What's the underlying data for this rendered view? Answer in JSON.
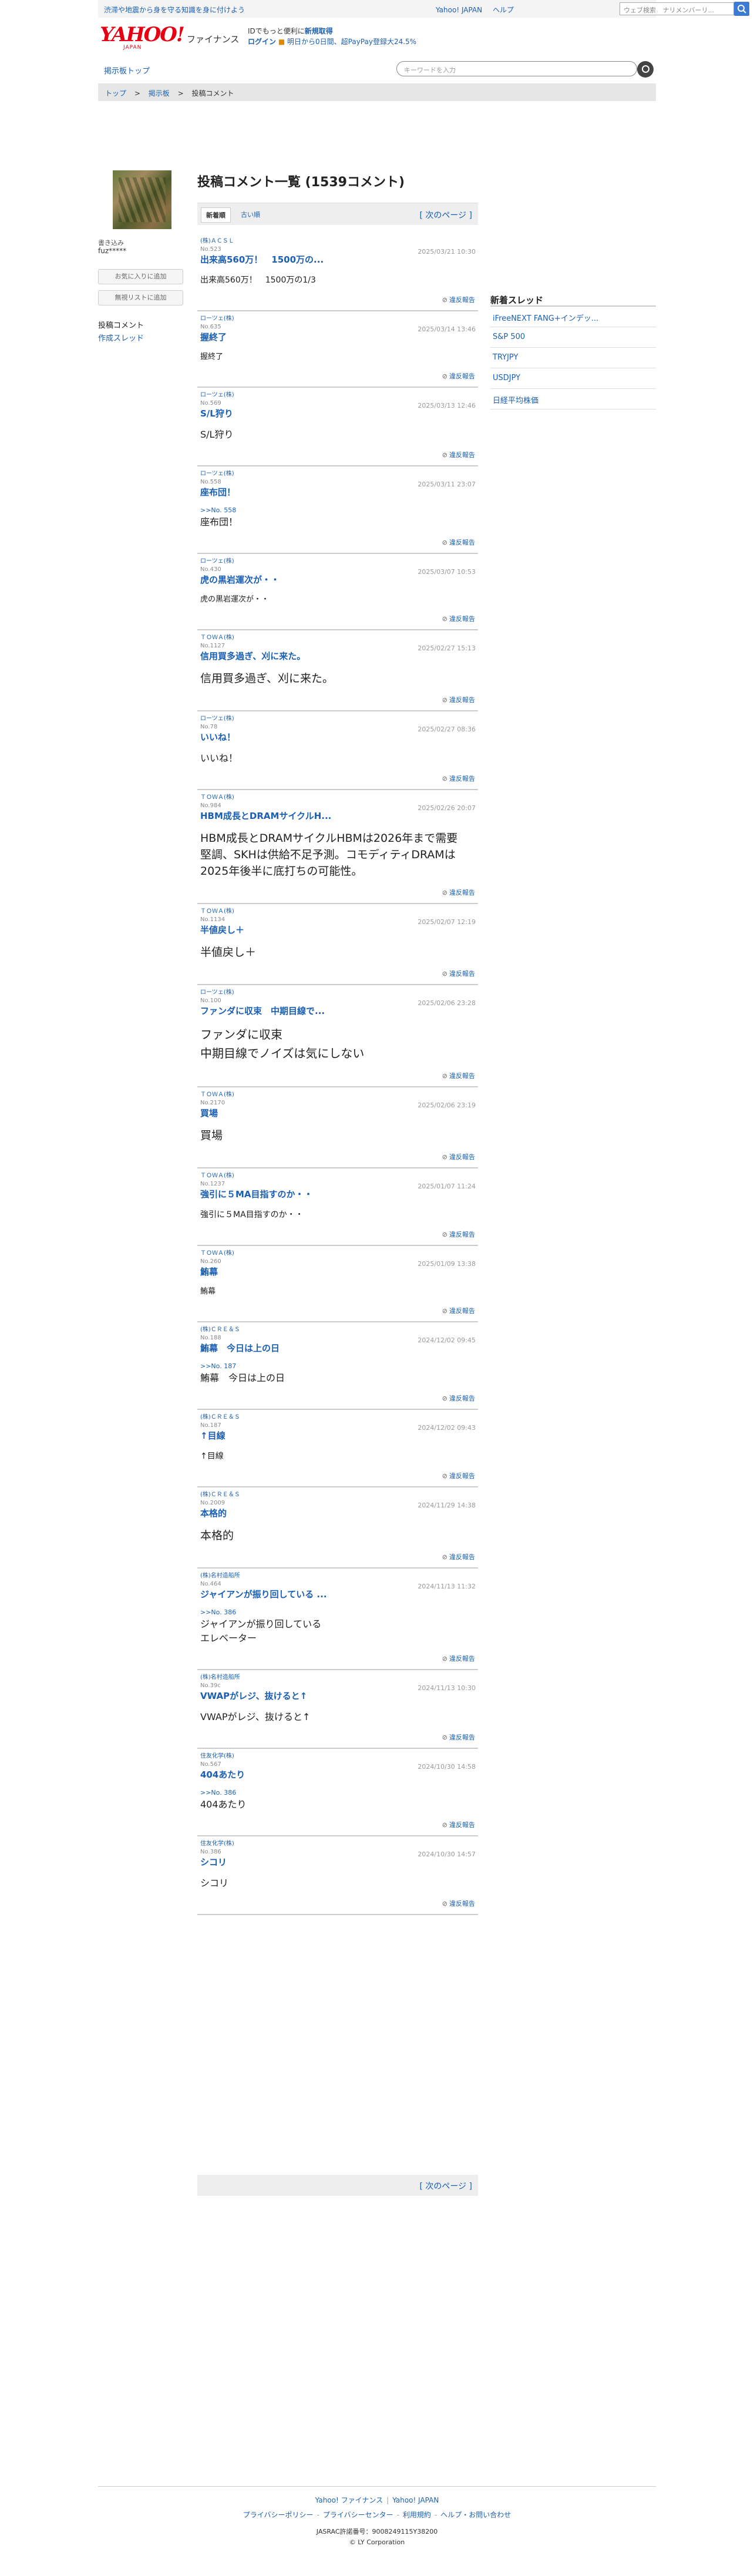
{
  "topbar": {
    "promo": "渋滞や地震から身を守る知識を身に付けよう",
    "links": [
      "Yahoo! JAPAN",
      "ヘルプ"
    ],
    "search_placeholder": "ウェブ検索",
    "search_option": "ナリ",
    "search_option2": "メンバーリ..."
  },
  "header": {
    "logo": "YAHOO!",
    "logo_sub": "JAPAN",
    "service": "ファイナンス",
    "promo_line1_a": "IDでもっと便利に",
    "promo_line1_b": "新規取得",
    "promo_line2_a": "ログイン",
    "promo_line2_b": "明日から0日間、超PayPay登録大24.5%"
  },
  "nav": {
    "board_top": "掲示板トップ",
    "keyword_placeholder": "キーワードを入力"
  },
  "breadcrumb": [
    "トップ",
    ">",
    "掲示板",
    ">",
    "投稿コメント"
  ],
  "profile": {
    "label": "書き込み",
    "name": "fuz*****",
    "btn_favorite": "お気に入りに追加",
    "btn_ignore": "無視リストに追加",
    "menu_comments": "投稿コメント",
    "menu_threads": "作成スレッド"
  },
  "main": {
    "title": "投稿コメント一覧 (1539コメント)",
    "tab_new": "新着順",
    "tab_old": "古い順",
    "next_page": "[ 次のページ ]",
    "report_label": "違反報告"
  },
  "posts": [
    {
      "company": "(株)ＡＣＳＬ",
      "no": "No.523",
      "date": "2025/03/21 10:30",
      "title": "出来高560万！　1500万の...",
      "reply": "",
      "body": "出来高560万！　1500万の1/3",
      "size": "fs14"
    },
    {
      "company": "ローツェ(株)",
      "no": "No.635",
      "date": "2025/03/14 13:46",
      "title": "握終了",
      "reply": "",
      "body": "握終了",
      "size": "fs13"
    },
    {
      "company": "ローツェ(株)",
      "no": "No.569",
      "date": "2025/03/13 12:46",
      "title": "S/L狩り",
      "reply": "",
      "body": "S/L狩り",
      "size": "fs16"
    },
    {
      "company": "ローツェ(株)",
      "no": "No.558",
      "date": "2025/03/11 23:07",
      "title": "座布団！",
      "reply": ">>No. 558",
      "body": "座布団！",
      "size": "fs16"
    },
    {
      "company": "ローツェ(株)",
      "no": "No.430",
      "date": "2025/03/07 10:53",
      "title": "虎の黒岩運次が・・",
      "reply": "",
      "body": "虎の黒岩運次が・・",
      "size": "fs13"
    },
    {
      "company": "ＴＯＷＡ(株)",
      "no": "No.1127",
      "date": "2025/02/27 15:13",
      "title": "信用買多過ぎ、刈に来た。",
      "reply": "",
      "body": "信用買多過ぎ、刈に来た。",
      "size": "fs19"
    },
    {
      "company": "ローツェ(株)",
      "no": "No.78",
      "date": "2025/02/27 08:36",
      "title": "いいね！",
      "reply": "",
      "body": "いいね！",
      "size": "fs16"
    },
    {
      "company": "ＴＯＷＡ(株)",
      "no": "No.984",
      "date": "2025/02/26 20:07",
      "title": "HBM成長とDRAMサイクルH...",
      "reply": "",
      "body": "HBM成長とDRAMサイクルHBMは2026年まで需要\n堅調、SKHは供給不足予測。コモディティDRAMは\n2025年後半に底打ちの可能性。",
      "size": "fs19"
    },
    {
      "company": "ＴＯＷＡ(株)",
      "no": "No.1134",
      "date": "2025/02/07 12:19",
      "title": "半値戻し＋",
      "reply": "",
      "body": "半値戻し＋",
      "size": "fs19"
    },
    {
      "company": "ローツェ(株)",
      "no": "No.100",
      "date": "2025/02/06 23:28",
      "title": "ファンダに収束　中期目線で...",
      "reply": "",
      "body": "ファンダに収束\n中期目線でノイズは気にしない",
      "size": "fs20"
    },
    {
      "company": "ＴＯＷＡ(株)",
      "no": "No.2170",
      "date": "2025/02/06 23:19",
      "title": "買場",
      "reply": "",
      "body": "買場",
      "size": "fs19"
    },
    {
      "company": "ＴＯＷＡ(株)",
      "no": "No.1237",
      "date": "2025/01/07 11:24",
      "title": "強引に５MA目指すのか・・",
      "reply": "",
      "body": "強引に５MA目指すのか・・",
      "size": "fs14"
    },
    {
      "company": "ＴＯＷＡ(株)",
      "no": "No.260",
      "date": "2025/01/09 13:38",
      "title": "鮪幕",
      "reply": "",
      "body": "鮪幕",
      "size": "fs13"
    },
    {
      "company": "(株)ＣＲＥ＆Ｓ",
      "no": "No.188",
      "date": "2024/12/02 09:45",
      "title": "鮪幕　今日は上の日",
      "reply": ">>No. 187",
      "body": "鮪幕　今日は上の日",
      "size": "fs16"
    },
    {
      "company": "(株)ＣＲＥ＆Ｓ",
      "no": "No.187",
      "date": "2024/12/02 09:43",
      "title": "↑目線",
      "reply": "",
      "body": "↑目線",
      "size": "fs14"
    },
    {
      "company": "(株)ＣＲＥ＆Ｓ",
      "no": "No.2009",
      "date": "2024/11/29 14:38",
      "title": "本格的",
      "reply": "",
      "body": "本格的",
      "size": "fs19"
    },
    {
      "company": "(株)名村造船所",
      "no": "No.464",
      "date": "2024/11/13 11:32",
      "title": "ジャイアンが振り回している ...",
      "reply": ">>No. 386",
      "body": "ジャイアンが振り回している\nエレベーター",
      "size": "fs16"
    },
    {
      "company": "(株)名村造船所",
      "no": "No.39c",
      "date": "2024/11/13 10:30",
      "title": "VWAPがレジ、抜けると↑",
      "reply": "",
      "body": "VWAPがレジ、抜けると↑",
      "size": "fs16"
    },
    {
      "company": "住友化学(株)",
      "no": "No.567",
      "date": "2024/10/30 14:58",
      "title": "404あたり",
      "reply": ">>No. 386",
      "body": "404あたり",
      "size": "fs16"
    },
    {
      "company": "住友化学(株)",
      "no": "No.386",
      "date": "2024/10/30 14:57",
      "title": "シコリ",
      "reply": "",
      "body": "シコリ",
      "size": "fs16"
    }
  ],
  "side": {
    "title": "新着スレッド",
    "items": [
      "iFreeNEXT FANG+インデッ...",
      "S&P 500",
      "TRYJPY",
      "USDJPY",
      "日経平均株価"
    ]
  },
  "footer": {
    "row1": [
      "Yahoo! ファイナンス",
      "Yahoo! JAPAN"
    ],
    "row2": [
      "プライバシーポリシー",
      "プライバシーセンター",
      "利用規約",
      "ヘルプ・お問い合わせ"
    ],
    "license": "JASRAC許諾番号：9008249115Y38200",
    "copyright": "© LY Corporation"
  }
}
